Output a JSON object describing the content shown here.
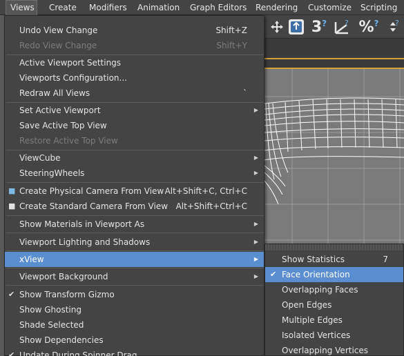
{
  "menubar": {
    "items": [
      {
        "label": "Views",
        "active": true
      },
      {
        "label": "Create"
      },
      {
        "label": "Modifiers"
      },
      {
        "label": "Animation"
      },
      {
        "label": "Graph Editors"
      },
      {
        "label": "Rendering"
      },
      {
        "label": "Customize"
      },
      {
        "label": "Scripting"
      }
    ]
  },
  "toolbar": {
    "icons": [
      "select-move-icon",
      "snap-toggle-icon",
      "angle-snap-icon",
      "percent-snap-icon",
      "spinner-snap-icon"
    ],
    "snap_label": "3"
  },
  "views_menu": {
    "items": [
      {
        "label": "Undo View Change",
        "shortcut": "Shift+Z",
        "disabled": false
      },
      {
        "label": "Redo View Change",
        "shortcut": "Shift+Y",
        "disabled": true
      },
      {
        "label": "Active Viewport Settings"
      },
      {
        "label": "Viewports Configuration..."
      },
      {
        "label": "Redraw All Views",
        "shortcut": "`"
      },
      {
        "label": "Set Active Viewport",
        "submenu": true
      },
      {
        "label": "Save Active Top View"
      },
      {
        "label": "Restore Active Top View",
        "disabled": true
      },
      {
        "label": "ViewCube",
        "submenu": true
      },
      {
        "label": "SteeringWheels",
        "submenu": true
      },
      {
        "label": "Create Physical Camera From View",
        "shortcut": "Alt+Shift+C, Ctrl+C",
        "icon": "physical-camera-icon"
      },
      {
        "label": "Create Standard Camera From View",
        "shortcut": "Alt+Shift+Ctrl+C",
        "icon": "standard-camera-icon"
      },
      {
        "label": "Show Materials in Viewport As",
        "submenu": true
      },
      {
        "label": "Viewport Lighting and Shadows",
        "submenu": true
      },
      {
        "label": "xView",
        "submenu": true,
        "highlight": true
      },
      {
        "label": "Viewport Background",
        "submenu": true
      },
      {
        "label": "Show Transform Gizmo",
        "checked": true
      },
      {
        "label": "Show Ghosting"
      },
      {
        "label": "Shade Selected"
      },
      {
        "label": "Show Dependencies"
      },
      {
        "label": "Update During Spinner Drag",
        "checked": true
      }
    ]
  },
  "xview_submenu": {
    "items": [
      {
        "label": "Show Statistics",
        "count": "7"
      },
      {
        "label": "Face Orientation",
        "checked": true,
        "highlight": true
      },
      {
        "label": "Overlapping Faces"
      },
      {
        "label": "Open Edges"
      },
      {
        "label": "Multiple Edges"
      },
      {
        "label": "Isolated Vertices"
      },
      {
        "label": "Overlapping Vertices"
      }
    ]
  },
  "colors": {
    "highlight": "#5b8ed0",
    "menu_bg": "#444444",
    "viewport_bg": "#7a7a7a",
    "viewport_border": "#d4a23a"
  }
}
